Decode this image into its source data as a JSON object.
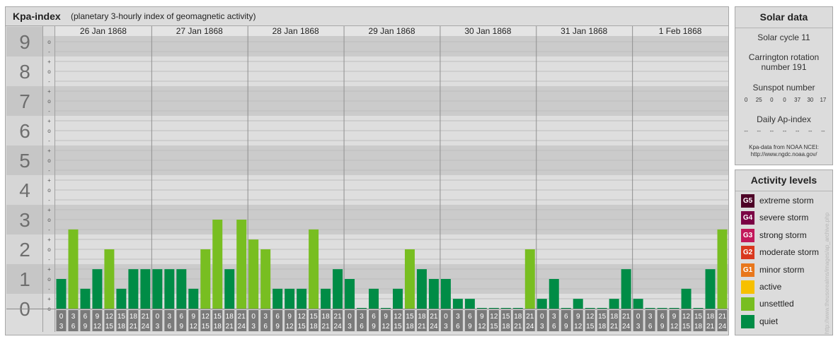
{
  "header": {
    "title": "Kpa-index",
    "subtitle": "(planetary 3-hourly index of geomagnetic activity)"
  },
  "chart_data": {
    "type": "bar",
    "y_ticks": [
      "0",
      "1",
      "2",
      "3",
      "4",
      "5",
      "6",
      "7",
      "8",
      "9"
    ],
    "sub_ticks": [
      "-",
      "o",
      "+"
    ],
    "ylim": [
      0,
      9.33
    ],
    "days": [
      "26 Jan 1868",
      "27 Jan 1868",
      "28 Jan 1868",
      "29 Jan 1868",
      "30 Jan 1868",
      "31 Jan 1868",
      "1 Feb 1868"
    ],
    "interval_top": [
      "0",
      "3",
      "6",
      "9",
      "12",
      "15",
      "18",
      "21"
    ],
    "interval_bottom": [
      "3",
      "6",
      "9",
      "12",
      "15",
      "18",
      "21",
      "24"
    ],
    "series": [
      {
        "values": [
          1.0,
          2.67,
          0.67,
          1.33,
          2.0,
          0.67,
          1.33,
          1.33,
          1.33,
          1.33,
          1.33,
          0.67,
          2.0,
          3.0,
          1.33,
          3.0,
          2.33,
          2.0,
          0.67,
          0.67,
          0.67,
          2.67,
          0.67,
          1.33,
          1.0,
          0.0,
          0.67,
          0.0,
          0.67,
          2.0,
          1.33,
          1.0,
          1.0,
          0.33,
          0.33,
          0.0,
          0.0,
          0.0,
          0.0,
          2.0,
          0.33,
          1.0,
          0.0,
          0.33,
          0.0,
          0.0,
          0.33,
          1.33,
          0.33,
          0.0,
          0.0,
          0.0,
          0.67,
          0.0,
          1.33,
          2.67
        ]
      }
    ],
    "colors": {
      "quiet": "#008c46",
      "unsettled": "#78be21"
    }
  },
  "solar": {
    "title": "Solar data",
    "cycle": "Solar cycle 11",
    "carrington": "Carrington rotation number 191",
    "sunspot_label": "Sunspot number",
    "sunspot_values": [
      "0",
      "25",
      "0",
      "0",
      "37",
      "30",
      "17"
    ],
    "ap_label": "Daily Ap-index",
    "ap_values": [
      "--",
      "--",
      "--",
      "--",
      "--",
      "--",
      "--"
    ],
    "source_line1": "Kpa-data from NOAA NCEI:",
    "source_line2": "http://www.ngdc.noaa.gov/"
  },
  "activity": {
    "title": "Activity levels",
    "levels": [
      {
        "code": "G5",
        "label": "extreme storm",
        "color": "#4d0026"
      },
      {
        "code": "G4",
        "label": "severe storm",
        "color": "#7a0044"
      },
      {
        "code": "G3",
        "label": "strong storm",
        "color": "#c2185b"
      },
      {
        "code": "G2",
        "label": "moderate storm",
        "color": "#d9381e"
      },
      {
        "code": "G1",
        "label": "minor storm",
        "color": "#e8771c"
      },
      {
        "code": "",
        "label": "active",
        "color": "#f7c000"
      },
      {
        "code": "",
        "label": "unsettled",
        "color": "#78be21"
      },
      {
        "code": "",
        "label": "quiet",
        "color": "#008c46"
      }
    ]
  },
  "credit": "http://www.theusorealms/images/ap_archive.php"
}
